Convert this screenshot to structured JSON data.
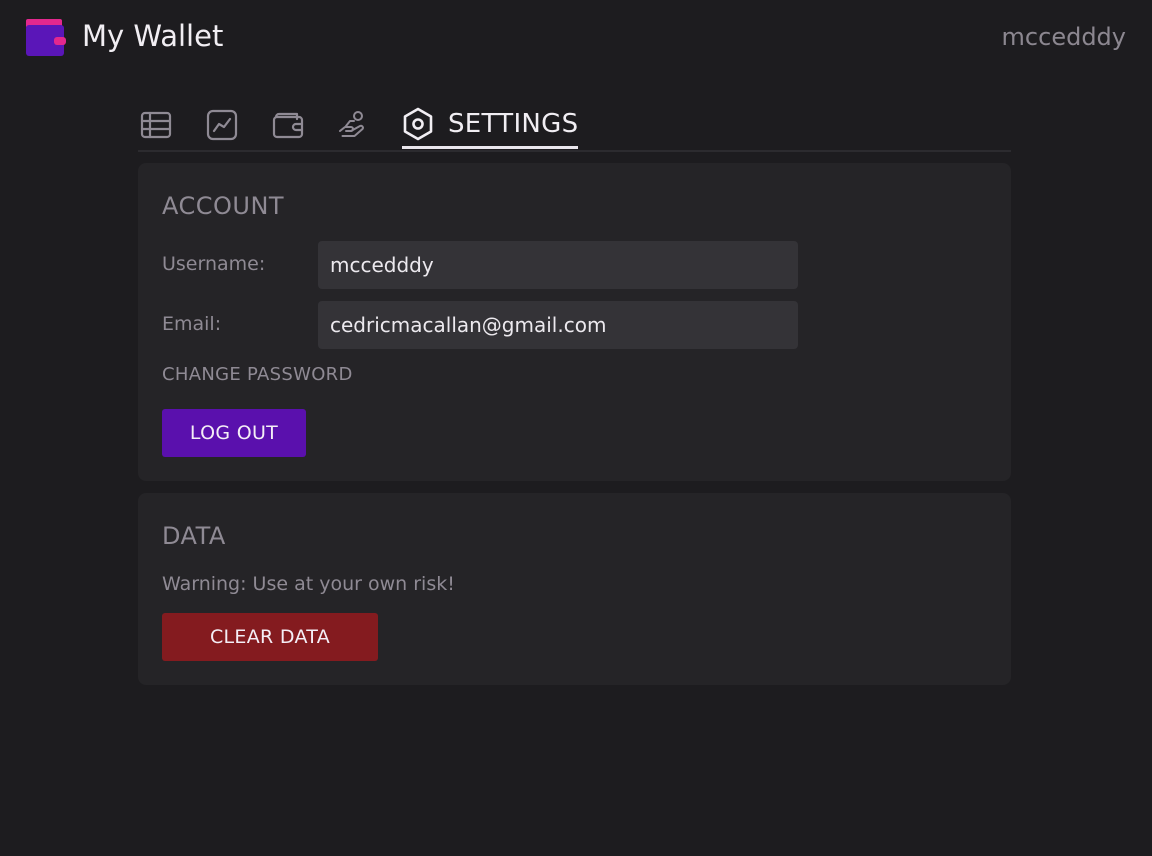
{
  "app": {
    "title": "My Wallet",
    "username": "mccedddy"
  },
  "tabs": [
    {
      "icon": "table-icon",
      "label": ""
    },
    {
      "icon": "chart-line-icon",
      "label": ""
    },
    {
      "icon": "wallet-icon",
      "label": ""
    },
    {
      "icon": "hand-coin-icon",
      "label": ""
    },
    {
      "icon": "settings-hexagon-icon",
      "label": "SETTINGS"
    }
  ],
  "account": {
    "title": "ACCOUNT",
    "username_label": "Username:",
    "username_value": "mccedddy",
    "email_label": "Email:",
    "email_value": "cedricmacallan@gmail.com",
    "change_password": "CHANGE PASSWORD",
    "logout": "LOG OUT"
  },
  "data": {
    "title": "DATA",
    "warning": "Warning: Use at your own risk!",
    "clear": "CLEAR DATA"
  },
  "colors": {
    "background": "#1d1c1f",
    "card": "#252427",
    "input": "#343337",
    "logout_button": "#5a10ad",
    "clear_button": "#841b1f",
    "logo_pink": "#e3288e",
    "logo_purple": "#5a16b8"
  }
}
